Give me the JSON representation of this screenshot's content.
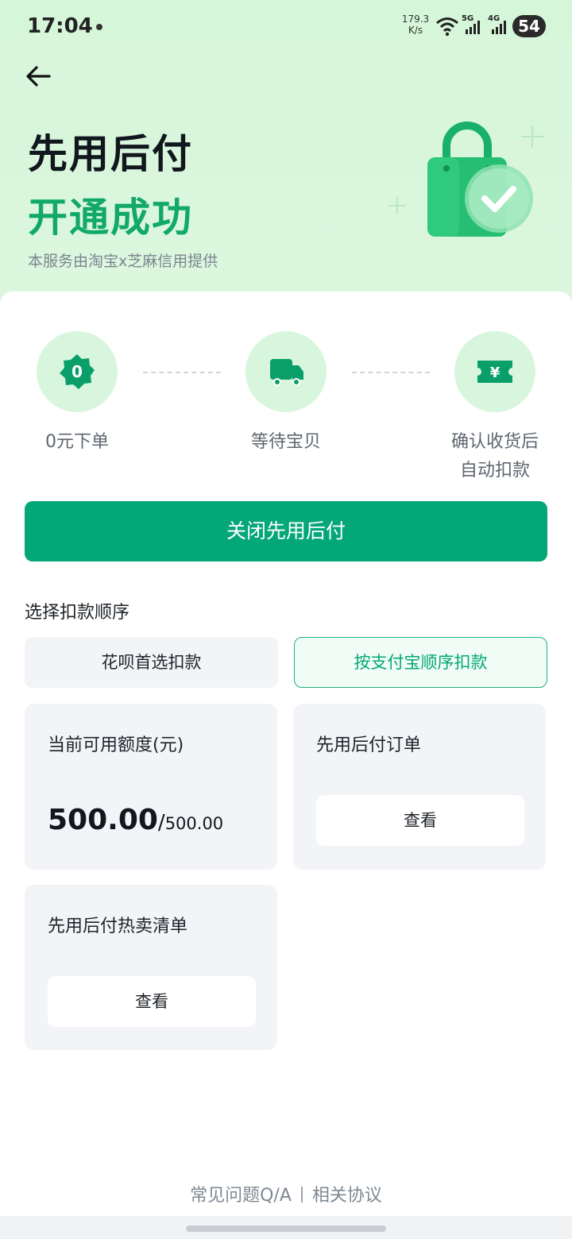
{
  "status_bar": {
    "time": "17:04",
    "net_speed_value": "179.3",
    "net_speed_unit": "K/s",
    "signal_1_label": "5G",
    "signal_2_label": "4G",
    "battery": "54"
  },
  "hero": {
    "title": "先用后付",
    "subtitle": "开通成功",
    "note": "本服务由淘宝x芝麻信用提供",
    "illustration_icon": "shopping-bag-check-icon"
  },
  "steps": [
    {
      "icon": "zero-badge-icon",
      "label": "0元下单"
    },
    {
      "icon": "truck-icon",
      "label": "等待宝贝"
    },
    {
      "icon": "yen-ticket-icon",
      "label_line1": "确认收货后",
      "label_line2": "自动扣款"
    }
  ],
  "primary_button": "关闭先用后付",
  "deduction": {
    "title": "选择扣款顺序",
    "options": [
      {
        "label": "花呗首选扣款",
        "selected": false
      },
      {
        "label": "按支付宝顺序扣款",
        "selected": true
      }
    ]
  },
  "panels": {
    "credit": {
      "title": "当前可用额度(元)",
      "current": "500.00",
      "separator": "/",
      "total": "500.00"
    },
    "orders": {
      "title": "先用后付订单",
      "button": "查看"
    },
    "hot_list": {
      "title": "先用后付热卖清单",
      "button": "查看"
    }
  },
  "footer": {
    "faq": "常见问题Q/A",
    "agreement": "相关协议"
  },
  "colors": {
    "accent": "#04a777",
    "hero_bg": "#d8f6dc",
    "success_text": "#12a86a",
    "panel_bg": "#f2f4f7"
  }
}
